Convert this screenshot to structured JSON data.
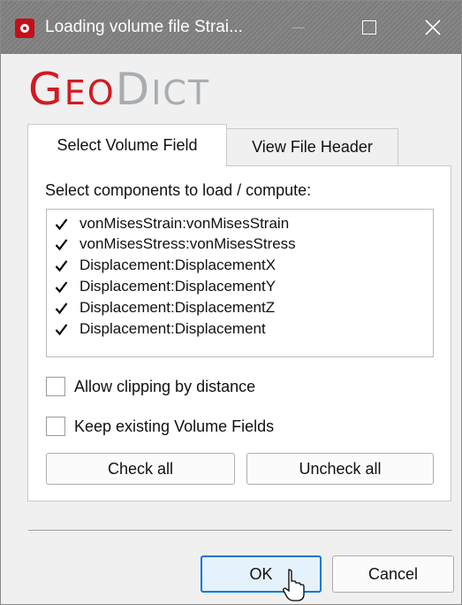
{
  "window": {
    "title": "Loading volume file Strai...",
    "controls": {
      "minimize": "minimize-icon",
      "maximize": "maximize-icon",
      "close": "close-icon"
    }
  },
  "logo": {
    "geo_initial": "G",
    "geo_rest": "EO",
    "dict_initial": "D",
    "dict_rest": "ICT"
  },
  "tabs": [
    {
      "label": "Select Volume Field",
      "active": true
    },
    {
      "label": "View File Header",
      "active": false
    }
  ],
  "components": {
    "label": "Select components to load / compute:",
    "items": [
      {
        "label": "vonMisesStrain:vonMisesStrain",
        "checked": true
      },
      {
        "label": "vonMisesStress:vonMisesStress",
        "checked": true
      },
      {
        "label": "Displacement:DisplacementX",
        "checked": true
      },
      {
        "label": "Displacement:DisplacementY",
        "checked": true
      },
      {
        "label": "Displacement:DisplacementZ",
        "checked": true
      },
      {
        "label": "Displacement:Displacement",
        "checked": true
      }
    ]
  },
  "options": {
    "allow_clipping": {
      "label": "Allow clipping by distance",
      "checked": false
    },
    "keep_existing": {
      "label": "Keep existing Volume Fields",
      "checked": false
    }
  },
  "buttons": {
    "check_all": "Check all",
    "uncheck_all": "Uncheck all",
    "ok": "OK",
    "cancel": "Cancel"
  },
  "colors": {
    "brand_red": "#d21a22",
    "brand_gray": "#a8adb1",
    "focus_blue": "#0078d7"
  }
}
